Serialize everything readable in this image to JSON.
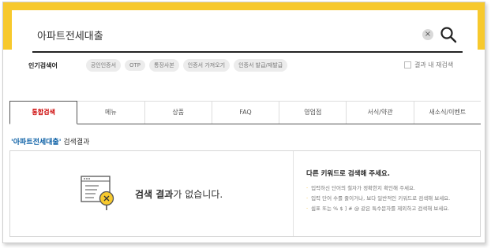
{
  "search": {
    "value": "아파트전세대출",
    "clear_symbol": "×"
  },
  "popular": {
    "label": "인기검색어",
    "chips": [
      "공인인증서",
      "OTP",
      "통장사본",
      "인증서 가져오기",
      "인증서 발급/재발급"
    ]
  },
  "search_within": {
    "label": "결과 내 재검색"
  },
  "tabs": [
    "통합검색",
    "메뉴",
    "상품",
    "FAQ",
    "영업점",
    "서식/약관",
    "새소식/이벤트"
  ],
  "active_tab": "통합검색",
  "result": {
    "keyword": "'아파트전세대출'",
    "suffix": " 검색결과",
    "empty_bold": "검색 결과",
    "empty_rest": "가 없습니다."
  },
  "tips": {
    "title": "다른 키워드로 검색해 주세요.",
    "items": [
      "입력하신 단어의 철자가 정확한지 확인해 주세요.",
      "입력 단어 수를 줄이거나, 보다 일반적인 키워드로 검색해 보세요.",
      "쉼표 또는 % $ ] # @ 같은 특수문자를 제외하고 검색해 보세요."
    ],
    "bullet": "·"
  },
  "colors": {
    "brand_yellow": "#f7c92d",
    "active_tab_text": "#cc0000",
    "keyword_blue": "#0b5fa5"
  }
}
